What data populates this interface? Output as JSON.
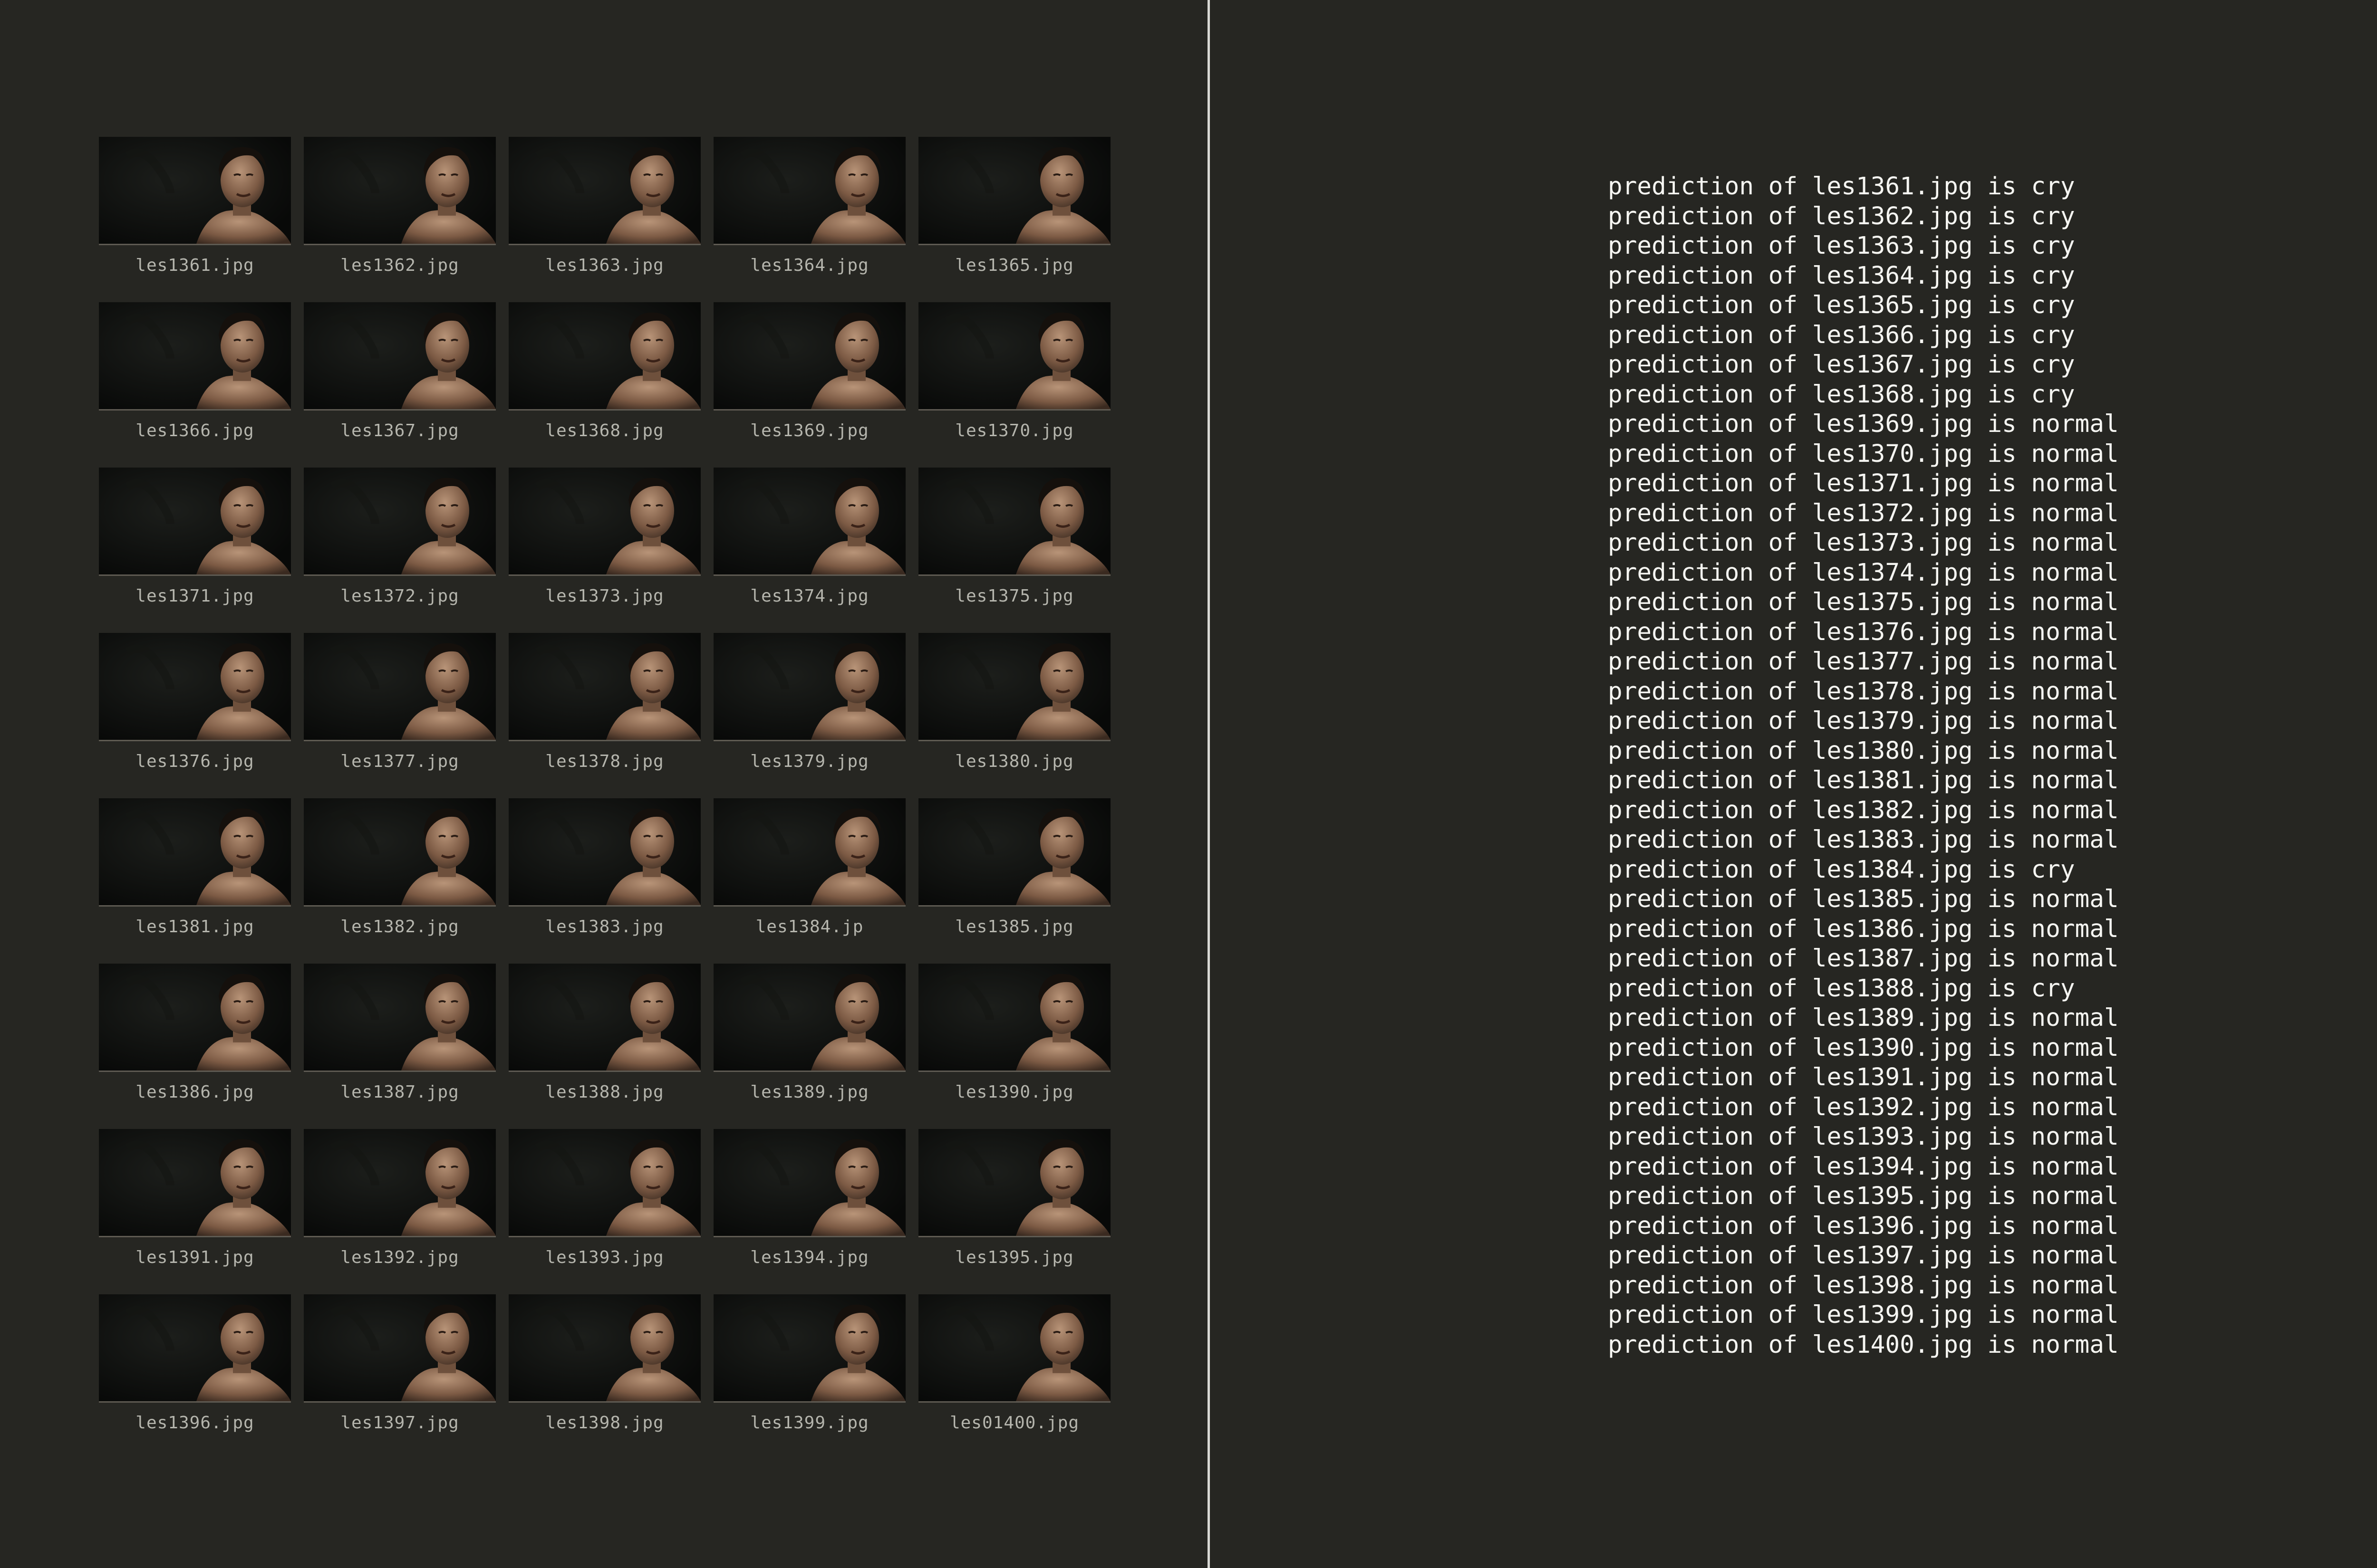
{
  "thumbnails": [
    "les1361.jpg",
    "les1362.jpg",
    "les1363.jpg",
    "les1364.jpg",
    "les1365.jpg",
    "les1366.jpg",
    "les1367.jpg",
    "les1368.jpg",
    "les1369.jpg",
    "les1370.jpg",
    "les1371.jpg",
    "les1372.jpg",
    "les1373.jpg",
    "les1374.jpg",
    "les1375.jpg",
    "les1376.jpg",
    "les1377.jpg",
    "les1378.jpg",
    "les1379.jpg",
    "les1380.jpg",
    "les1381.jpg",
    "les1382.jpg",
    "les1383.jpg",
    "les1384.jp",
    "les1385.jpg",
    "les1386.jpg",
    "les1387.jpg",
    "les1388.jpg",
    "les1389.jpg",
    "les1390.jpg",
    "les1391.jpg",
    "les1392.jpg",
    "les1393.jpg",
    "les1394.jpg",
    "les1395.jpg",
    "les1396.jpg",
    "les1397.jpg",
    "les1398.jpg",
    "les1399.jpg",
    "les01400.jpg"
  ],
  "predictions": [
    "prediction of les1361.jpg is cry",
    "prediction of les1362.jpg is cry",
    "prediction of les1363.jpg is cry",
    "prediction of les1364.jpg is cry",
    "prediction of les1365.jpg is cry",
    "prediction of les1366.jpg is cry",
    "prediction of les1367.jpg is cry",
    "prediction of les1368.jpg is cry",
    "prediction of les1369.jpg is normal",
    "prediction of les1370.jpg is normal",
    "prediction of les1371.jpg is normal",
    "prediction of les1372.jpg is normal",
    "prediction of les1373.jpg is normal",
    "prediction of les1374.jpg is normal",
    "prediction of les1375.jpg is normal",
    "prediction of les1376.jpg is normal",
    "prediction of les1377.jpg is normal",
    "prediction of les1378.jpg is normal",
    "prediction of les1379.jpg is normal",
    "prediction of les1380.jpg is normal",
    "prediction of les1381.jpg is normal",
    "prediction of les1382.jpg is normal",
    "prediction of les1383.jpg is normal",
    "prediction of les1384.jpg is cry",
    "prediction of les1385.jpg is normal",
    "prediction of les1386.jpg is normal",
    "prediction of les1387.jpg is normal",
    "prediction of les1388.jpg is cry",
    "prediction of les1389.jpg is normal",
    "prediction of les1390.jpg is normal",
    "prediction of les1391.jpg is normal",
    "prediction of les1392.jpg is normal",
    "prediction of les1393.jpg is normal",
    "prediction of les1394.jpg is normal",
    "prediction of les1395.jpg is normal",
    "prediction of les1396.jpg is normal",
    "prediction of les1397.jpg is normal",
    "prediction of les1398.jpg is normal",
    "prediction of les1399.jpg is normal",
    "prediction of les1400.jpg is normal"
  ]
}
